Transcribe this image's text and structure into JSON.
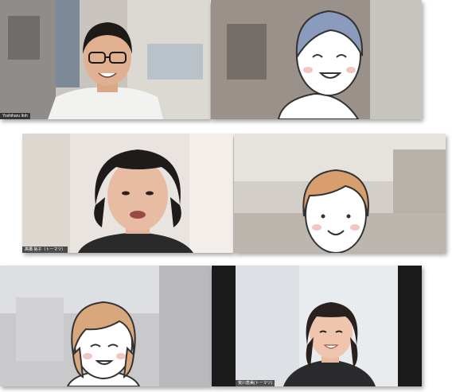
{
  "participants": [
    {
      "name": "Yoshiharu Itoh",
      "kind": "video"
    },
    {
      "name": "",
      "kind": "avatar-illustration"
    },
    {
      "name": "髙橋 裕子（トーマツ）",
      "kind": "video"
    },
    {
      "name": "",
      "kind": "avatar-illustration"
    },
    {
      "name": "",
      "kind": "avatar-illustration"
    },
    {
      "name": "荒川恵美(トーマツ)",
      "kind": "video"
    }
  ]
}
